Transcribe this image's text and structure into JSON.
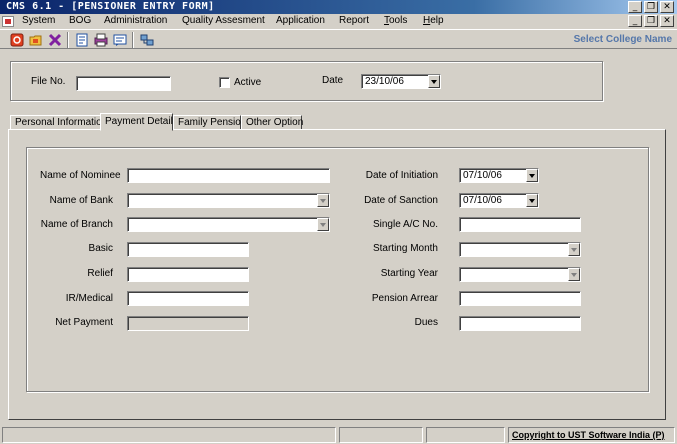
{
  "window": {
    "title": "CMS 6.1 - [PENSIONER ENTRY FORM]",
    "controls": {
      "minimize": "_",
      "restore": "❐",
      "close": "✕"
    }
  },
  "menu": {
    "items": [
      "System",
      "BOG",
      "Administration",
      "Quality Assesment",
      "Application",
      "Report",
      "Tools",
      "Help"
    ]
  },
  "toolbar": {
    "icons": [
      "power-icon",
      "open-folder-icon",
      "delete-icon",
      "new-document-icon",
      "print-preview-icon",
      "report-icon",
      "network-icon"
    ],
    "college_label": "Select College Name"
  },
  "header": {
    "file_no_label": "File No.",
    "file_no_value": "",
    "active_label": "Active",
    "active_checked": false,
    "date_label": "Date",
    "date_value": "23/10/06"
  },
  "tabs": [
    {
      "label": "Personal Information"
    },
    {
      "label": "Payment Detail",
      "active": true
    },
    {
      "label": "Family Pension"
    },
    {
      "label": "Other Option"
    }
  ],
  "payment": {
    "name_of_nominee_label": "Name of Nominee",
    "name_of_nominee_value": "",
    "name_of_bank_label": "Name of Bank",
    "name_of_bank_value": "",
    "name_of_branch_label": "Name of Branch",
    "name_of_branch_value": "",
    "basic_label": "Basic",
    "basic_value": "",
    "relief_label": "Relief",
    "relief_value": "",
    "ir_medical_label": "IR/Medical",
    "ir_medical_value": "",
    "net_payment_label": "Net Payment",
    "net_payment_value": "",
    "date_of_initiation_label": "Date of Initiation",
    "date_of_initiation_value": "07/10/06",
    "date_of_sanction_label": "Date of Sanction",
    "date_of_sanction_value": "07/10/06",
    "single_ac_no_label": "Single A/C No.",
    "single_ac_no_value": "",
    "starting_month_label": "Starting Month",
    "starting_month_value": "",
    "starting_year_label": "Starting Year",
    "starting_year_value": "",
    "pension_arrear_label": "Pension Arrear",
    "pension_arrear_value": "",
    "dues_label": "Dues",
    "dues_value": ""
  },
  "status": {
    "copyright": "Copyright to UST Software India (P)"
  }
}
